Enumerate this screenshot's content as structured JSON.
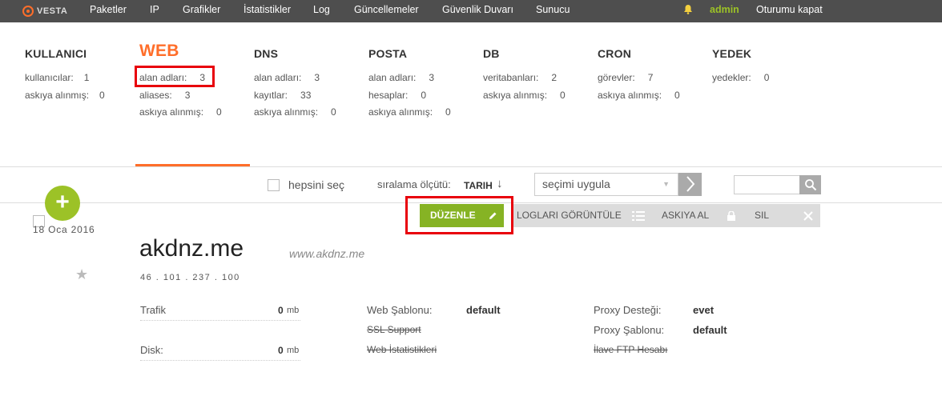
{
  "nav": {
    "logo": "VESTA",
    "items": [
      "Paketler",
      "IP",
      "Grafikler",
      "İstatistikler",
      "Log",
      "Güncellemeler",
      "Güvenlik Duvarı",
      "Sunucu"
    ],
    "user": "admin",
    "logout": "Oturumu kapat"
  },
  "stats": {
    "user": {
      "title": "KULLANICI",
      "rows": [
        {
          "label": "kullanıcılar:",
          "value": "1"
        },
        {
          "label": "askıya alınmış:",
          "value": "0"
        }
      ]
    },
    "web": {
      "title": "WEB",
      "rows": [
        {
          "label": "alan adları:",
          "value": "3"
        },
        {
          "label": "aliases:",
          "value": "3"
        },
        {
          "label": "askıya alınmış:",
          "value": "0"
        }
      ]
    },
    "dns": {
      "title": "DNS",
      "rows": [
        {
          "label": "alan adları:",
          "value": "3"
        },
        {
          "label": "kayıtlar:",
          "value": "33"
        },
        {
          "label": "askıya alınmış:",
          "value": "0"
        }
      ]
    },
    "mail": {
      "title": "POSTA",
      "rows": [
        {
          "label": "alan adları:",
          "value": "3"
        },
        {
          "label": "hesaplar:",
          "value": "0"
        },
        {
          "label": "askıya alınmış:",
          "value": "0"
        }
      ]
    },
    "db": {
      "title": "DB",
      "rows": [
        {
          "label": "veritabanları:",
          "value": "2"
        },
        {
          "label": "askıya alınmış:",
          "value": "0"
        }
      ]
    },
    "cron": {
      "title": "CRON",
      "rows": [
        {
          "label": "görevler:",
          "value": "7"
        },
        {
          "label": "askıya alınmış:",
          "value": "0"
        }
      ]
    },
    "backup": {
      "title": "YEDEK",
      "rows": [
        {
          "label": "yedekler:",
          "value": "0"
        }
      ]
    }
  },
  "toolbar": {
    "select_all": "hepsini seç",
    "sort_label": "sıralama ölçütü:",
    "sort_value": "TARIH",
    "sort_arrow": "↓",
    "action_select": "seçimi uygula"
  },
  "actions": {
    "edit": "DÜZENLE",
    "logs": "LOGLARI GÖRÜNTÜLE",
    "suspend": "ASKIYA AL",
    "delete": "SIL"
  },
  "domain_row": {
    "date": "18 Oca 2016",
    "domain": "akdnz.me",
    "alias": "www.akdnz.me",
    "ip": "46 . 101 . 237 . 100",
    "traffic_label": "Trafik",
    "traffic_value": "0",
    "traffic_unit": "mb",
    "disk_label": "Disk:",
    "disk_value": "0",
    "disk_unit": "mb",
    "web_template_label": "Web Şablonu:",
    "web_template_value": "default",
    "ssl_label": "SSL Support",
    "web_stats_label": "Web İstatistikleri",
    "proxy_support_label": "Proxy Desteği:",
    "proxy_support_value": "evet",
    "proxy_template_label": "Proxy Şablonu:",
    "proxy_template_value": "default",
    "ftp_label": "İlave FTP Hesabı"
  },
  "colors": {
    "accent": "#ff6e2a",
    "nav_bg": "#4e4e4e",
    "green": "#86b324",
    "highlight": "#e8000b"
  }
}
